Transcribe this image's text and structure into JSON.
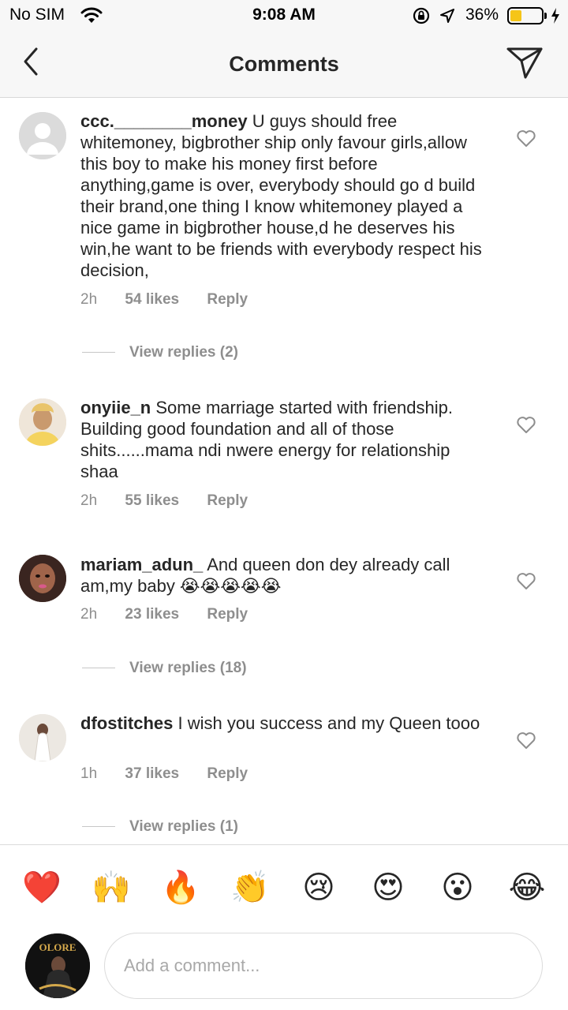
{
  "status_bar": {
    "carrier": "No SIM",
    "time": "9:08 AM",
    "battery_percent": "36%",
    "battery_level": 0.36,
    "icons": [
      "wifi-icon",
      "orientation-lock-icon",
      "location-icon",
      "battery-icon",
      "charging-icon"
    ]
  },
  "header": {
    "title": "Comments",
    "back_icon": "chevron-left-icon",
    "send_icon": "paper-plane-icon"
  },
  "comments": [
    {
      "username": "ccc.________money",
      "text": "U guys should free whitemoney, bigbrother ship only favour girls,allow this boy to make his money first before anything,game is over, everybody should go d build their brand,one thing I know whitemoney played a nice game in bigbrother house,d he deserves his win,he want to be friends with everybody respect his decision,",
      "time": "2h",
      "likes": "54 likes",
      "reply": "Reply",
      "view_replies": "View replies (2)"
    },
    {
      "username": "onyiie_n",
      "text": "Some marriage started with friendship. Building good foundation and all of those shits......mama ndi nwere energy for relationship shaa",
      "time": "2h",
      "likes": "55 likes",
      "reply": "Reply",
      "view_replies": ""
    },
    {
      "username": "mariam_adun_",
      "text": "And queen don dey already call am,my baby 😭😭😭😭😭",
      "time": "2h",
      "likes": "23 likes",
      "reply": "Reply",
      "view_replies": "View replies (18)"
    },
    {
      "username": "dfostitches",
      "text": "I wish you success and my Queen tooo",
      "time": "1h",
      "likes": "37 likes",
      "reply": "Reply",
      "view_replies": "View replies (1)"
    }
  ],
  "quick_reactions": [
    "❤️",
    "🙌",
    "🔥",
    "👏",
    "😢",
    "😍",
    "😮",
    "😂"
  ],
  "composer": {
    "placeholder": "Add a comment...",
    "avatar_text": "OLORE"
  },
  "colors": {
    "text": "#262626",
    "secondary": "#8e8e8e",
    "divider": "#dbdbdb",
    "battery": "#f5c518"
  }
}
